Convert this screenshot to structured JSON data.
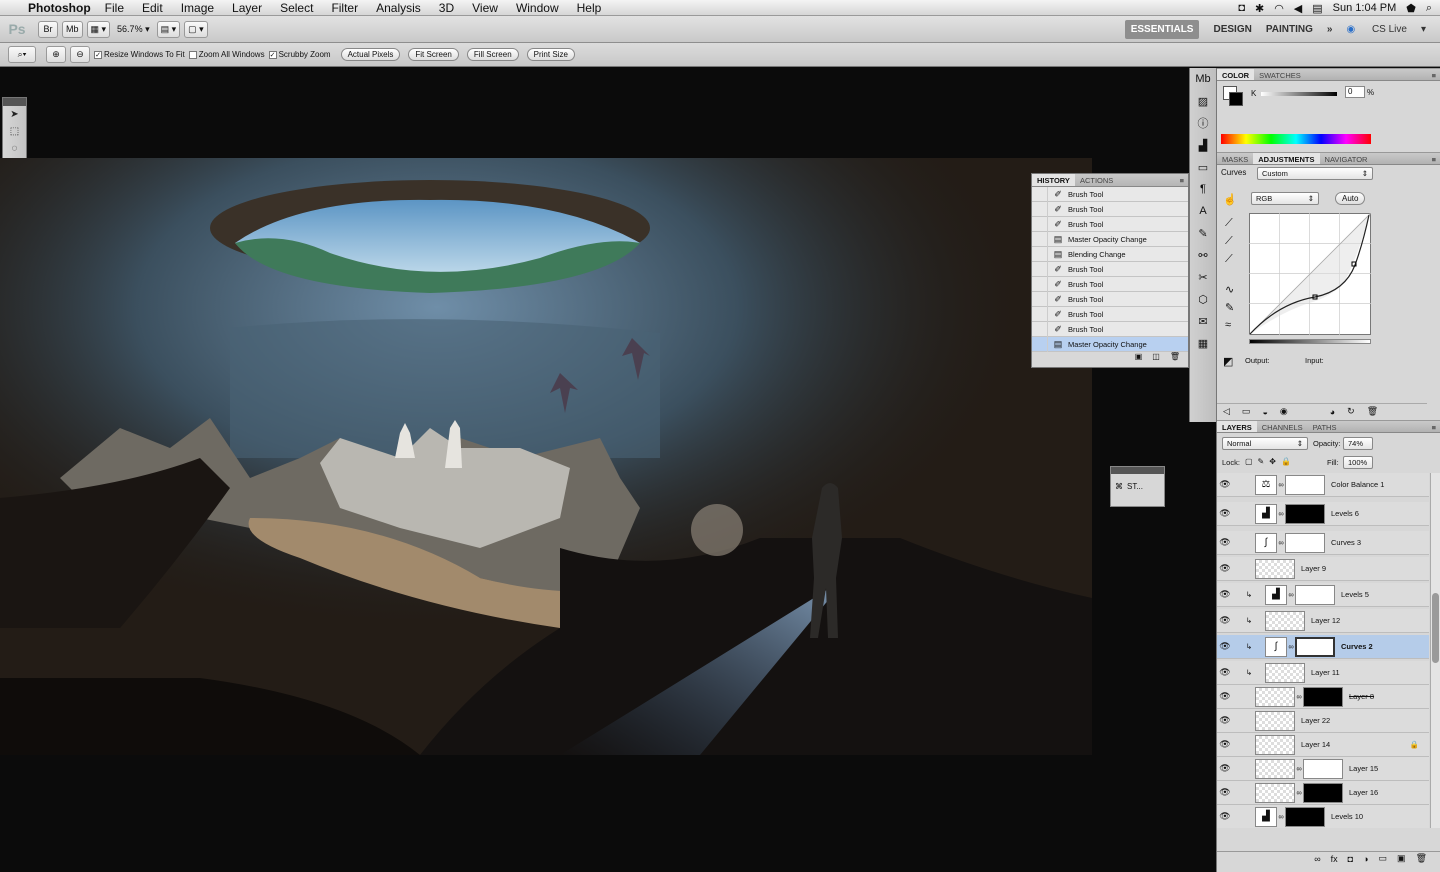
{
  "menubar": {
    "app": "Photoshop",
    "items": [
      "File",
      "Edit",
      "Image",
      "Layer",
      "Select",
      "Filter",
      "Analysis",
      "3D",
      "View",
      "Window",
      "Help"
    ],
    "clock": "Sun 1:04 PM"
  },
  "appbar": {
    "zoom": "56.7%",
    "workspaces": [
      "ESSENTIALS",
      "DESIGN",
      "PAINTING"
    ],
    "more": "»",
    "cslive": "CS Live"
  },
  "options": {
    "chk_resize": "Resize Windows To Fit",
    "chk_zoomall": "Zoom All Windows",
    "chk_scrubby": "Scrubby Zoom",
    "btn_actual": "Actual Pixels",
    "btn_fit": "Fit Screen",
    "btn_fill": "Fill Screen",
    "btn_print": "Print Size"
  },
  "history": {
    "tabs": [
      "HISTORY",
      "ACTIONS"
    ],
    "items": [
      "Brush Tool",
      "Brush Tool",
      "Brush Tool",
      "Master Opacity Change",
      "Blending Change",
      "Brush Tool",
      "Brush Tool",
      "Brush Tool",
      "Brush Tool",
      "Brush Tool",
      "Master Opacity Change"
    ]
  },
  "color": {
    "tabs": [
      "COLOR",
      "SWATCHES"
    ],
    "channel": "K",
    "value": "0",
    "unit": "%"
  },
  "adjustments": {
    "tabs": [
      "MASKS",
      "ADJUSTMENTS",
      "NAVIGATOR"
    ],
    "label": "Curves",
    "preset": "Custom",
    "channel": "RGB",
    "auto": "Auto",
    "output": "Output:",
    "input": "Input:"
  },
  "layers": {
    "tabs": [
      "LAYERS",
      "CHANNELS",
      "PATHS"
    ],
    "blend": "Normal",
    "opacity_label": "Opacity:",
    "opacity": "74%",
    "lock_label": "Lock:",
    "fill_label": "Fill:",
    "fill": "100%",
    "rows": [
      "Color Balance 1",
      "Levels 6",
      "Curves 3",
      "Layer 9",
      "Levels 5",
      "Layer 12",
      "Curves 2",
      "Layer 11",
      "Layer 8",
      "Layer 22",
      "Layer 14",
      "Layer 15",
      "Layer 16",
      "Levels 10"
    ]
  },
  "mini_panel": "ST..."
}
